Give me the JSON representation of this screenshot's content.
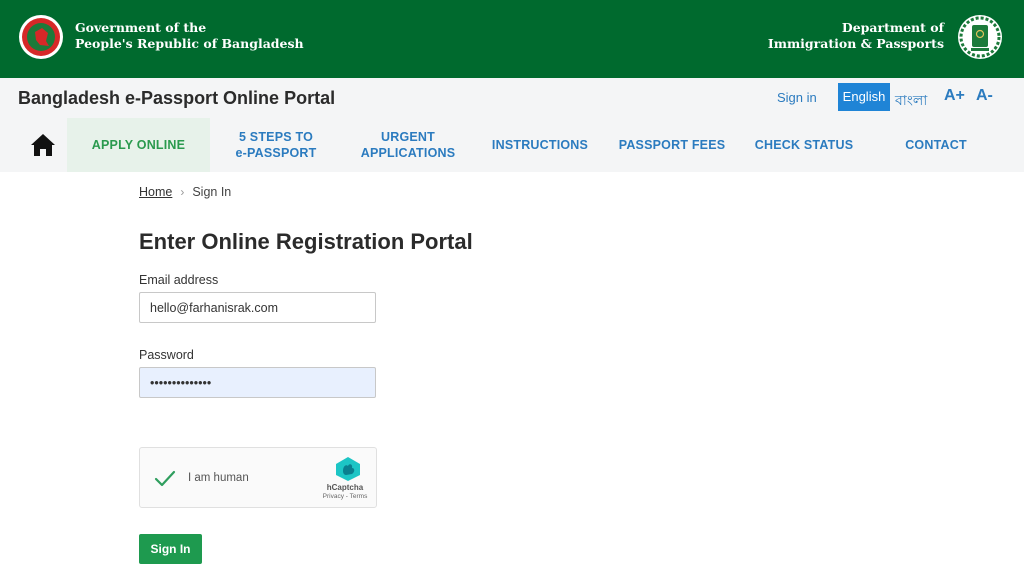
{
  "header": {
    "gov_line1": "Government of the",
    "gov_line2": "People's Republic of Bangladesh",
    "dept_line1": "Department of",
    "dept_line2": "Immigration & Passports",
    "bg_color": "#006a2e"
  },
  "portal": {
    "title": "Bangladesh e-Passport Online Portal",
    "signin_label": "Sign in",
    "lang_en": "English",
    "lang_bn": "বাংলা",
    "font_increase": "A+",
    "font_decrease": "A-"
  },
  "nav": {
    "home_icon": "home-icon",
    "items": [
      {
        "label": "APPLY ONLINE",
        "active": true
      },
      {
        "label": "5 STEPS TO\ne-PASSPORT"
      },
      {
        "label": "URGENT\nAPPLICATIONS"
      },
      {
        "label": "INSTRUCTIONS"
      },
      {
        "label": "PASSPORT FEES"
      },
      {
        "label": "CHECK STATUS"
      },
      {
        "label": "CONTACT"
      }
    ]
  },
  "breadcrumb": {
    "home": "Home",
    "current": "Sign In"
  },
  "form": {
    "title": "Enter Online Registration Portal",
    "email_label": "Email address",
    "email_value": "hello@farhanisrak.com",
    "password_label": "Password",
    "password_value": "••••••••••••••",
    "captcha_label": "I am human",
    "captcha_brand": "hCaptcha",
    "captcha_links": "Privacy - Terms",
    "submit_label": "Sign In"
  }
}
